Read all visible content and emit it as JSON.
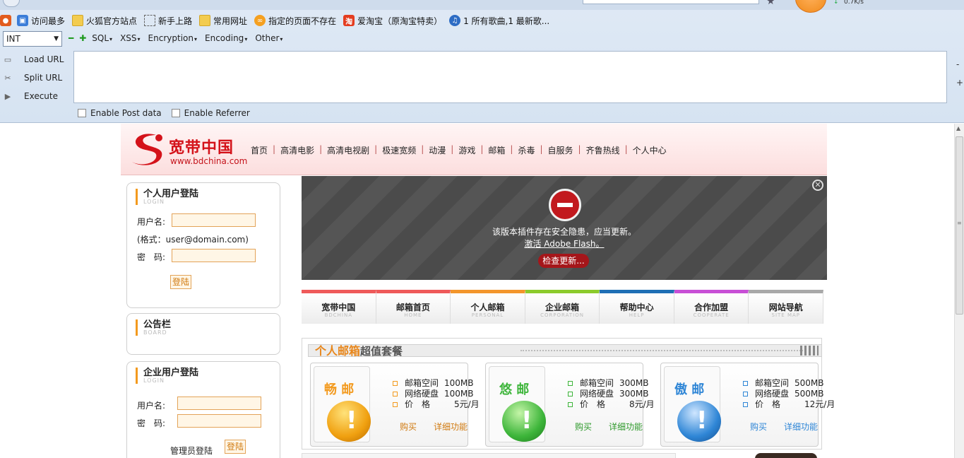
{
  "browser": {
    "download_speed": "0.7K/s",
    "bookmarks": [
      {
        "label": "访问最多",
        "icon": "most-visited-icon"
      },
      {
        "label": "火狐官方站点",
        "icon": "folder-icon"
      },
      {
        "label": "新手上路",
        "icon": "new-user-icon"
      },
      {
        "label": "常用网址",
        "icon": "folder-icon"
      },
      {
        "label": "指定的页面不存在",
        "icon": "orange-site-icon"
      },
      {
        "label": "爱淘宝（原淘宝特卖）",
        "icon": "taobao-icon"
      },
      {
        "label": "1 所有歌曲,1 最新歌...",
        "icon": "music-icon"
      }
    ]
  },
  "hackbar": {
    "select_value": "INT",
    "menus": [
      "SQL",
      "XSS",
      "Encryption",
      "Encoding",
      "Other"
    ],
    "load_url": "Load URL",
    "split_url": "Split URL",
    "execute": "Execute",
    "url_value": "",
    "enable_post": "Enable Post data",
    "enable_referrer": "Enable Referrer",
    "side_minus": "-",
    "side_plus": "+"
  },
  "site": {
    "logo_cn": "宽带中国",
    "logo_url": "www.bdchina.com",
    "nav": [
      "首页",
      "高清电影",
      "高清电视剧",
      "极速宽频",
      "动漫",
      "游戏",
      "邮箱",
      "杀毒",
      "自服务",
      "齐鲁热线",
      "个人中心"
    ],
    "personal_login": {
      "title": "个人用户登陆",
      "title_en": "LOGIN",
      "username_label": "用户名:",
      "format_hint": "(格式：user@domain.com)",
      "password_label": "密　码:",
      "login_button": "登陆"
    },
    "board": {
      "title": "公告栏",
      "title_en": "BOARD"
    },
    "enterprise_login": {
      "title": "企业用户登陆",
      "title_en": "LOGIN",
      "username_label": "用户名:",
      "password_label": "密　码:",
      "admin_label": "管理员登陆",
      "login_button": "登陆"
    },
    "flash": {
      "message": "该版本插件存在安全隐患，应当更新。",
      "activate": "激活 Adobe Flash。",
      "check_update": "检查更新..."
    },
    "tabs": [
      {
        "cn": "宽带中国",
        "en": "BDCHINA",
        "color": "#ef5a5a"
      },
      {
        "cn": "邮箱首页",
        "en": "HOME",
        "color": "#ef5a5a"
      },
      {
        "cn": "个人邮箱",
        "en": "PERSONAL",
        "color": "#f3962c"
      },
      {
        "cn": "企业邮箱",
        "en": "CORPORATION",
        "color": "#8ccb2c"
      },
      {
        "cn": "帮助中心",
        "en": "HELP",
        "color": "#1f6fb5"
      },
      {
        "cn": "合作加盟",
        "en": "COOPERATE",
        "color": "#c84fd6"
      },
      {
        "cn": "网站导航",
        "en": "SITE MAP",
        "color": "#a8a8a8"
      }
    ],
    "package": {
      "title_orange": "个人邮箱",
      "title_gray": "超值套餐",
      "cards": [
        {
          "name": "畅 邮",
          "color": "#f39a1e",
          "space_label": "邮箱空间",
          "space": "100MB",
          "disk_label": "网络硬盘",
          "disk": "100MB",
          "price_label": "价　格",
          "price": "5元/月",
          "buy": "购买",
          "details": "详细功能"
        },
        {
          "name": "悠 邮",
          "color": "#3db53a",
          "space_label": "邮箱空间",
          "space": "300MB",
          "disk_label": "网络硬盘",
          "disk": "300MB",
          "price_label": "价　格",
          "price": "8元/月",
          "buy": "购买",
          "details": "详细功能"
        },
        {
          "name": "傲 邮",
          "color": "#2f86d6",
          "space_label": "邮箱空间",
          "space": "500MB",
          "disk_label": "网络硬盘",
          "disk": "500MB",
          "price_label": "价　格",
          "price": "12元/月",
          "buy": "购买",
          "details": "详细功能"
        }
      ]
    }
  }
}
